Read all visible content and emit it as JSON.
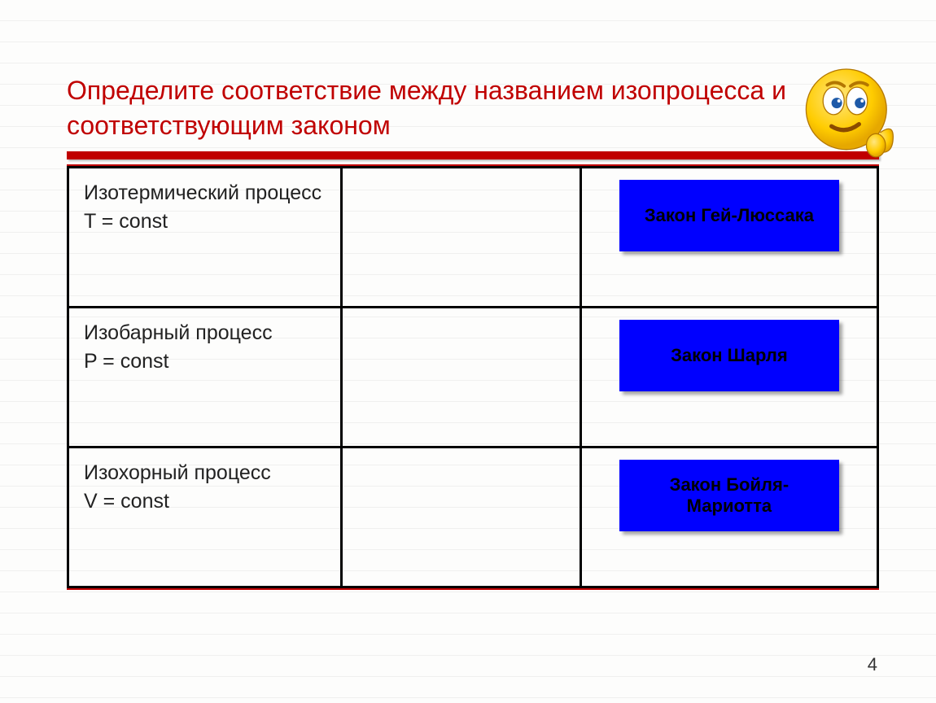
{
  "title": "Определите соответствие между названием изопроцесса и соответствующим законом",
  "rows": [
    {
      "name": "Изотермический процесс",
      "eq": "T = const",
      "law": "Закон Гей-Люссака"
    },
    {
      "name": "Изобарный процесс",
      "eq": "P = const",
      "law": "Закон Шарля"
    },
    {
      "name": "Изохорный процесс",
      "eq": "V = const",
      "law": "Закон Бойля-Мариотта"
    }
  ],
  "page_number": "4"
}
